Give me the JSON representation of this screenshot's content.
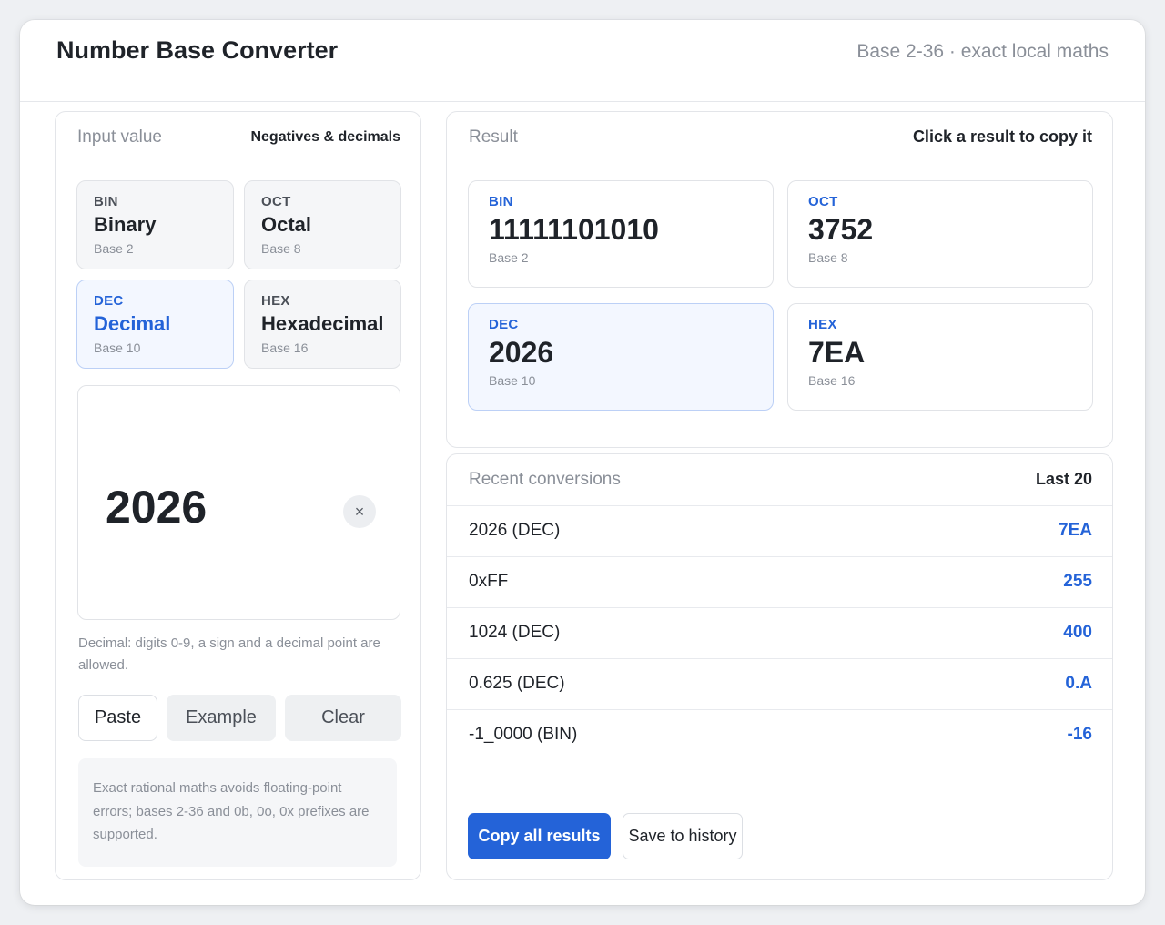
{
  "header": {
    "title": "Number Base Converter",
    "subtitle": "Base 2-36 · exact local maths"
  },
  "input": {
    "title": "Input value",
    "aside": "Negatives & decimals",
    "bases": [
      {
        "code": "BIN",
        "name": "Binary",
        "base": "Base 2"
      },
      {
        "code": "OCT",
        "name": "Octal",
        "base": "Base 8"
      },
      {
        "code": "DEC",
        "name": "Decimal",
        "base": "Base 10"
      },
      {
        "code": "HEX",
        "name": "Hexadecimal",
        "base": "Base 16"
      }
    ],
    "selected_base": "DEC",
    "value": "2026",
    "clear_icon": "×",
    "hint": "Decimal: digits 0-9, a sign and a decimal point are allowed.",
    "paste_label": "Paste",
    "example_label": "Example",
    "clear_label": "Clear",
    "note": "Exact rational maths avoids floating-point errors; bases 2-36 and 0b, 0o, 0x prefixes are supported."
  },
  "result": {
    "title": "Result",
    "aside": "Click a result to copy it",
    "tiles": [
      {
        "code": "BIN",
        "value": "11111101010",
        "base": "Base 2"
      },
      {
        "code": "OCT",
        "value": "3752",
        "base": "Base 8"
      },
      {
        "code": "DEC",
        "value": "2026",
        "base": "Base 10"
      },
      {
        "code": "HEX",
        "value": "7EA",
        "base": "Base 16"
      }
    ]
  },
  "history": {
    "title": "Recent conversions",
    "aside": "Last 20",
    "rows": [
      {
        "input": "2026 (DEC)",
        "output": "7EA"
      },
      {
        "input": "0xFF",
        "output": "255"
      },
      {
        "input": "1024 (DEC)",
        "output": "400"
      },
      {
        "input": "0.625 (DEC)",
        "output": "0.A"
      },
      {
        "input": "-1_0000 (BIN)",
        "output": "-16"
      }
    ],
    "copy_label": "Copy all results",
    "save_label": "Save to history"
  },
  "colors": {
    "accent": "#2463d8",
    "active_bg": "#f3f7ff",
    "muted_text": "#8a8f98"
  }
}
